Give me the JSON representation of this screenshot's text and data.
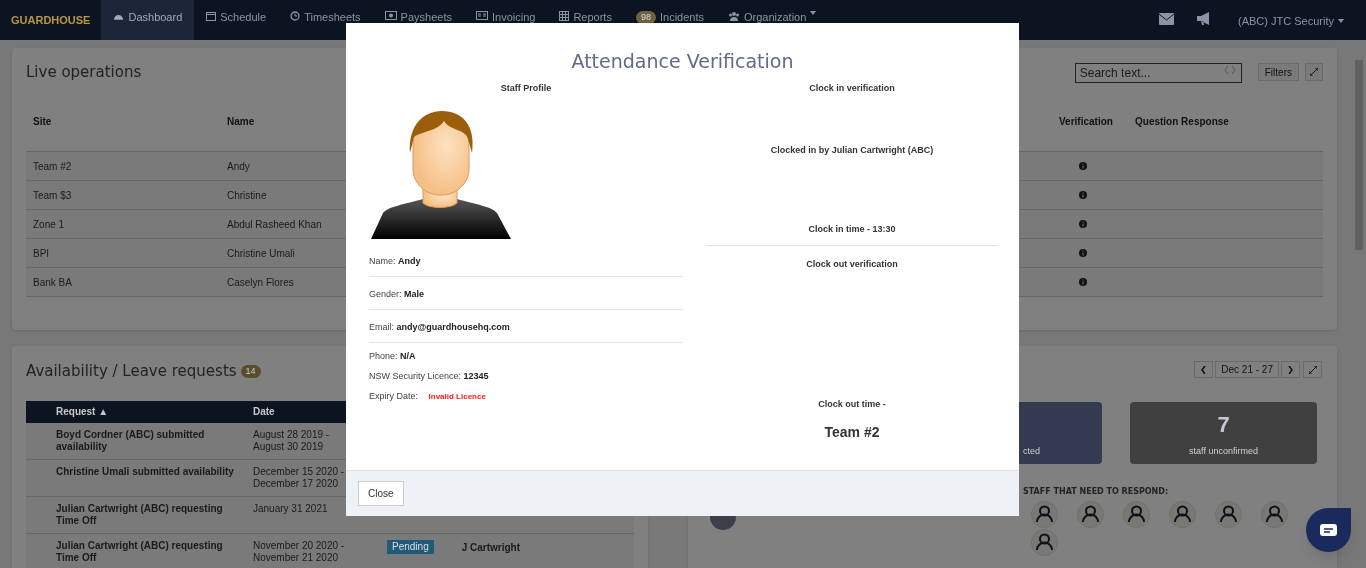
{
  "navbar": {
    "logo": "GUARDHOUSE",
    "items": [
      {
        "label": "Dashboard",
        "selected": true
      },
      {
        "label": "Schedule",
        "selected": false
      },
      {
        "label": "Timesheets",
        "selected": false
      },
      {
        "label": "Paysheets",
        "selected": false
      },
      {
        "label": "Invoicing",
        "selected": false
      },
      {
        "label": "Reports",
        "selected": false
      },
      {
        "label": "Incidents",
        "badge": "98",
        "selected": false
      },
      {
        "label": "Organization",
        "selected": false
      }
    ],
    "account": "(ABC) JTC Security"
  },
  "live_operations": {
    "title": "Live operations",
    "search": {
      "placeholder": "Search text..."
    },
    "filters_button": "Filters",
    "columns": [
      "Site",
      "Name",
      "Verification",
      "Question Response"
    ],
    "rows": [
      {
        "site": "Team #2",
        "name": "Andy"
      },
      {
        "site": "Team $3",
        "name": "Christine"
      },
      {
        "site": "Zone 1",
        "name": "Abdul Rasheed Khan"
      },
      {
        "site": "BPI",
        "name": "Christine Umali"
      },
      {
        "site": "Bank BA",
        "name": "Caselyn Flores"
      }
    ]
  },
  "leave_requests": {
    "title": "Availability / Leave requests",
    "count": "14",
    "columns": [
      "Request ▲",
      "Date"
    ],
    "rows": [
      {
        "request": "Boyd Cordner (ABC) submitted availability",
        "date": "August 28 2019 - August 30 2019"
      },
      {
        "request": "Christine Umali submitted availability",
        "date": "December 15 2020 - December 17 2020"
      },
      {
        "request": "Julian Cartwright (ABC) requesting Time Off",
        "date": "January 31 2021"
      },
      {
        "request": "Julian Cartwright (ABC) requesting Time Off",
        "date": "November 20 2020 - November 21 2020",
        "status": "Pending",
        "by": "J Cartwright"
      }
    ]
  },
  "shifts": {
    "date_range": "Dec 21 - 27",
    "stats": [
      {
        "label": "cted",
        "color": "#343a4f"
      },
      {
        "value": "7",
        "label": "staff unconfirmed",
        "color": "#404040"
      }
    ],
    "respond_title": "STAFF THAT NEED TO RESPOND:"
  },
  "modal": {
    "title": "Attendance Verification",
    "profile": {
      "heading": "Staff Profile",
      "fields": [
        {
          "label": "Name:",
          "value": "Andy",
          "divider": true
        },
        {
          "label": "Gender:",
          "value": "Male",
          "divider": true
        },
        {
          "label": "Email:",
          "value": "andy@guardhousehq.com",
          "divider": true
        },
        {
          "label": "Phone:",
          "value": "N/A",
          "divider": false
        },
        {
          "label": "NSW Security Licence:",
          "value": "12345",
          "divider": false
        },
        {
          "label": "Expiry Date:",
          "value": "Invalid Licence",
          "divider": false,
          "kind": "warning"
        }
      ]
    },
    "clock_in": {
      "heading": "Clock in verification",
      "by": "Clocked in by Julian Cartwright (ABC)",
      "time": "Clock in time - 13:30"
    },
    "clock_out": {
      "heading": "Clock out verification",
      "time": "Clock out time -",
      "site": "Team #2"
    },
    "close_button": "Close"
  }
}
